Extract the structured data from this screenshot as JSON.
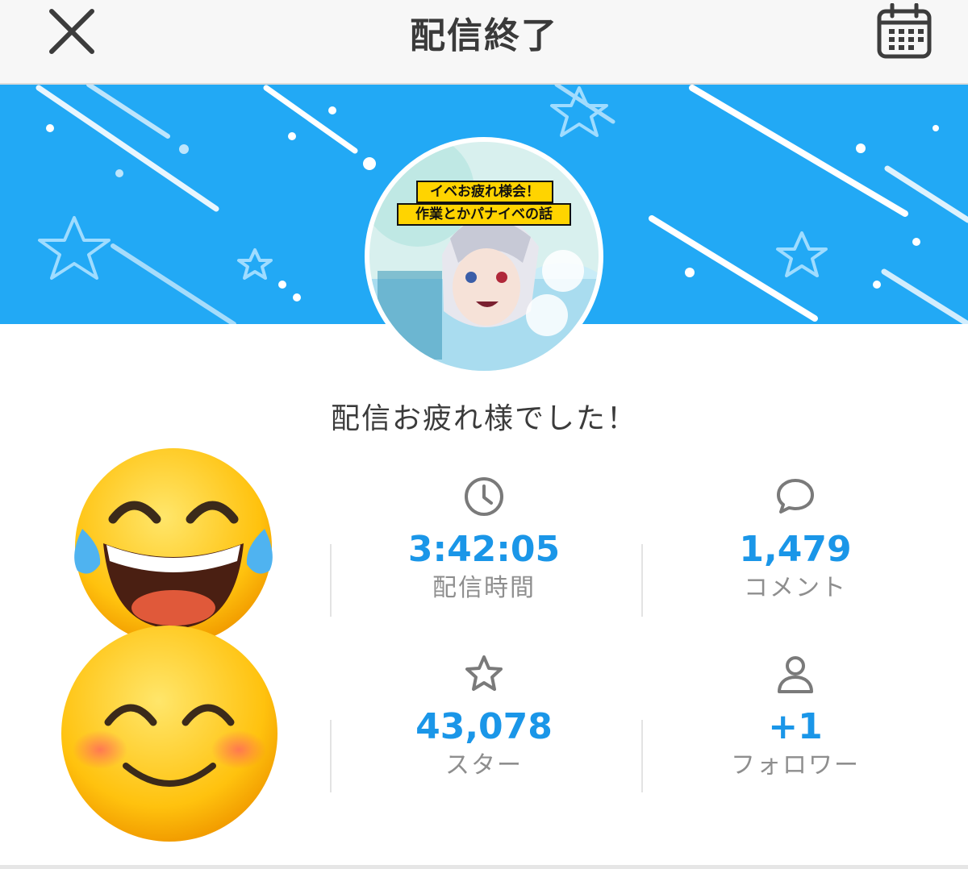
{
  "header": {
    "title": "配信終了",
    "close_icon": "close-icon",
    "calendar_icon": "calendar-icon"
  },
  "banner": {
    "background_color": "#22a9f5"
  },
  "stream": {
    "thumbnail_caption_line1": "イベお疲れ様会！",
    "thumbnail_caption_line2": "作業とかパナイベの話"
  },
  "message": "配信お疲れ様でした！",
  "stats": {
    "duration": {
      "value": "3:42:05",
      "label": "配信時間",
      "icon": "clock-icon"
    },
    "comments": {
      "value": "1,479",
      "label": "コメント",
      "icon": "speech-bubble-icon"
    },
    "stars": {
      "value": "43,078",
      "label": "スター",
      "icon": "star-icon"
    },
    "followers": {
      "value": "+1",
      "label": "フォロワー",
      "icon": "person-icon"
    }
  },
  "colors": {
    "accent": "#1a96e8",
    "label": "#8e8e8e",
    "icon": "#7a7a7a"
  }
}
